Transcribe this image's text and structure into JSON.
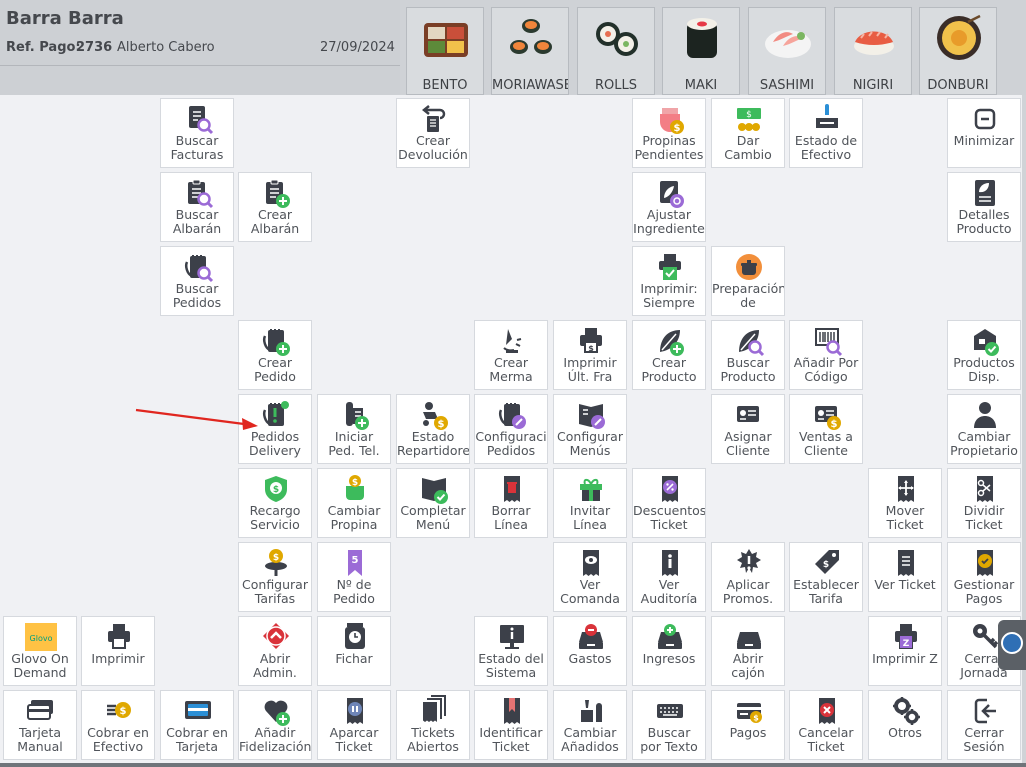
{
  "header": {
    "title": "Barra Barra",
    "ref_label": "Ref. Pago:",
    "ref_number": "2736",
    "customer": "Alberto Cabero",
    "date": "27/09/2024"
  },
  "categories": [
    {
      "label": "BENTO",
      "icon": "bento-box-icon"
    },
    {
      "label": "MORIAWASE",
      "icon": "moriawase-sushi-icon"
    },
    {
      "label": "ROLLS",
      "icon": "sushi-rolls-icon"
    },
    {
      "label": "MAKI",
      "icon": "maki-icon"
    },
    {
      "label": "SASHIMI",
      "icon": "sashimi-icon"
    },
    {
      "label": "NIGIRI",
      "icon": "nigiri-icon"
    },
    {
      "label": "DONBURI",
      "icon": "donburi-bowl-icon"
    }
  ],
  "menu": [
    {
      "label": "Buscar\nFacturas",
      "icon": "search-invoice-icon"
    },
    {
      "label": "Crear\nDevolución",
      "icon": "return-receipt-icon"
    },
    {
      "label": "Propinas\nPendientes",
      "icon": "pending-tips-icon"
    },
    {
      "label": "Dar\nCambio",
      "icon": "give-change-icon"
    },
    {
      "label": "Estado de\nEfectivo",
      "icon": "cash-status-icon"
    },
    {
      "label": "Minimizar",
      "icon": "minimize-icon"
    },
    {
      "label": "Buscar\nAlbarán",
      "icon": "search-delivery-note-icon"
    },
    {
      "label": "Crear\nAlbarán",
      "icon": "create-delivery-note-icon"
    },
    {
      "label": "Ajustar\nIngrediente",
      "icon": "adjust-ingredient-icon"
    },
    {
      "label": "Detalles\nProducto",
      "icon": "product-details-icon"
    },
    {
      "label": "Buscar\nPedidos",
      "icon": "search-orders-icon"
    },
    {
      "label": "Imprimir:\nSiempre",
      "icon": "print-always-icon"
    },
    {
      "label": "Preparación\nde",
      "icon": "preparation-pot-icon"
    },
    {
      "label": "Crear\nPedido",
      "icon": "create-order-icon"
    },
    {
      "label": "Crear\nMerma",
      "icon": "create-waste-icon"
    },
    {
      "label": "Imprimir\nÚlt. Fra",
      "icon": "print-last-invoice-icon"
    },
    {
      "label": "Crear\nProducto",
      "icon": "create-product-icon"
    },
    {
      "label": "Buscar\nProducto",
      "icon": "search-product-icon"
    },
    {
      "label": "Añadir Por\nCódigo",
      "icon": "barcode-add-icon"
    },
    {
      "label": "Productos\nDisp.",
      "icon": "available-products-icon"
    },
    {
      "label": "Pedidos\nDelivery",
      "icon": "delivery-orders-icon"
    },
    {
      "label": "Iniciar\nPed. Tel.",
      "icon": "phone-order-icon"
    },
    {
      "label": "Estado\nRepartidores",
      "icon": "delivery-driver-status-icon"
    },
    {
      "label": "Configuraci\nPedidos",
      "icon": "configure-orders-icon"
    },
    {
      "label": "Configurar\nMenús",
      "icon": "configure-menus-icon"
    },
    {
      "label": "Asignar\nCliente",
      "icon": "assign-client-icon"
    },
    {
      "label": "Ventas a\nCliente",
      "icon": "client-sales-icon"
    },
    {
      "label": "Cambiar\nPropietario",
      "icon": "change-owner-icon"
    },
    {
      "label": "Recargo\nServicio",
      "icon": "service-surcharge-icon"
    },
    {
      "label": "Cambiar\nPropina",
      "icon": "change-tip-icon"
    },
    {
      "label": "Completar\nMenú",
      "icon": "complete-menu-icon"
    },
    {
      "label": "Borrar\nLínea",
      "icon": "delete-line-icon"
    },
    {
      "label": "Invitar\nLínea",
      "icon": "gift-line-icon"
    },
    {
      "label": "Descuentos\nTicket",
      "icon": "ticket-discount-icon"
    },
    {
      "label": "Mover\nTicket",
      "icon": "move-ticket-icon"
    },
    {
      "label": "Dividir\nTicket",
      "icon": "split-ticket-icon"
    },
    {
      "label": "Configurar\nTarifas",
      "icon": "configure-rates-icon"
    },
    {
      "label": "Nº de\nPedido",
      "icon": "order-number-icon"
    },
    {
      "label": "Ver\nComanda",
      "icon": "view-order-slip-icon"
    },
    {
      "label": "Ver\nAuditoría",
      "icon": "view-audit-icon"
    },
    {
      "label": "Aplicar\nPromos.",
      "icon": "apply-promos-icon"
    },
    {
      "label": "Establecer\nTarifa",
      "icon": "set-rate-tag-icon"
    },
    {
      "label": "Ver Ticket",
      "icon": "view-ticket-icon"
    },
    {
      "label": "Gestionar\nPagos",
      "icon": "manage-payments-icon"
    },
    {
      "label": "Glovo On\nDemand",
      "icon": "glovo-logo-icon"
    },
    {
      "label": "Imprimir",
      "icon": "printer-icon"
    },
    {
      "label": "Abrir\nAdmin.",
      "icon": "open-admin-icon"
    },
    {
      "label": "Fichar",
      "icon": "clock-in-icon"
    },
    {
      "label": "Estado del\nSistema",
      "icon": "system-status-icon"
    },
    {
      "label": "Gastos",
      "icon": "expenses-icon"
    },
    {
      "label": "Ingresos",
      "icon": "income-icon"
    },
    {
      "label": "Abrir\ncajón",
      "icon": "open-drawer-icon"
    },
    {
      "label": "Imprimir Z",
      "icon": "print-z-icon"
    },
    {
      "label": "Cerrar\nJornada",
      "icon": "close-day-key-icon"
    },
    {
      "label": "Tarjeta\nManual",
      "icon": "manual-card-icon"
    },
    {
      "label": "Cobrar en\nEfectivo",
      "icon": "cash-payment-icon"
    },
    {
      "label": "Cobrar en\nTarjeta",
      "icon": "card-payment-icon"
    },
    {
      "label": "Añadir\nFidelización",
      "icon": "add-loyalty-icon"
    },
    {
      "label": "Aparcar\nTicket",
      "icon": "park-ticket-icon"
    },
    {
      "label": "Tickets\nAbiertos",
      "icon": "open-tickets-icon"
    },
    {
      "label": "Identificar\nTicket",
      "icon": "identify-ticket-icon"
    },
    {
      "label": "Cambiar\nAñadidos",
      "icon": "change-addons-icon"
    },
    {
      "label": "Buscar\npor Texto",
      "icon": "keyboard-search-icon"
    },
    {
      "label": "Pagos",
      "icon": "payments-icon"
    },
    {
      "label": "Cancelar\nTicket",
      "icon": "cancel-ticket-icon"
    },
    {
      "label": "Otros",
      "icon": "gears-icon"
    },
    {
      "label": "Cerrar\nSesión",
      "icon": "logout-icon"
    }
  ],
  "colors": {
    "icon_dark": "#3c4049",
    "accent_green": "#3dbb5c",
    "accent_purple": "#9b6bd6",
    "accent_gold": "#e0a800",
    "accent_red": "#d9333a",
    "arrow_red": "#e0261f"
  }
}
